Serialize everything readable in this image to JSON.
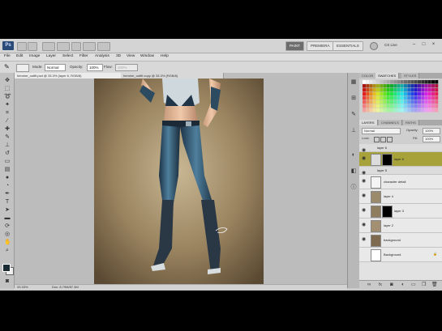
{
  "appbar": {
    "logo": "Ps",
    "workspaces": [
      "PAINT",
      "PREMIERA",
      "ESSENTIALS"
    ],
    "active_workspace": "PAINT",
    "cs_live": "CS Live",
    "minimize": "–",
    "maximize": "□",
    "close": "×"
  },
  "menu": [
    "File",
    "Edit",
    "Image",
    "Layer",
    "Select",
    "Filter",
    "Analysis",
    "3D",
    "View",
    "Window",
    "Help"
  ],
  "options": {
    "mode_label": "Mode:",
    "mode_value": "Normal",
    "opacity_label": "Opacity:",
    "opacity_value": "100%",
    "flow_label": "Flow:",
    "flow_value": "100%"
  },
  "tools": [
    "move",
    "marquee",
    "lasso",
    "quick-select",
    "crop",
    "eyedropper",
    "healing",
    "brush",
    "clone-stamp",
    "history-brush",
    "eraser",
    "gradient",
    "blur",
    "dodge",
    "pen",
    "type",
    "path-select",
    "shape",
    "3d-rotate",
    "3d-orbit",
    "hand",
    "zoom"
  ],
  "document": {
    "tabs": [
      "heroine_outfit.psd @ 33.3% (layer 6, RGB/8)",
      "heroine_outfit copy @ 33.3% (RGB/8)"
    ],
    "status_zoom": "33.33%",
    "status_doc": "Doc: 8.79M/87.3M"
  },
  "panels": {
    "top_tabs": [
      "COLOR",
      "SWATCHES",
      "STYLES"
    ],
    "active_top_tab": "SWATCHES",
    "layer_tabs": [
      "LAYERS",
      "CHANNELS",
      "PATHS"
    ],
    "active_layer_tab": "LAYERS",
    "blend_mode": "Normal",
    "opacity_label": "Opacity:",
    "opacity_value": "100%",
    "lock_label": "Lock:",
    "fill_label": "Fill:",
    "fill_value": "100%",
    "layers": [
      {
        "name": "layer 6",
        "type": "group",
        "visible": true,
        "selected": false
      },
      {
        "name": "layer 6",
        "type": "mask",
        "visible": true,
        "selected": true
      },
      {
        "name": "layer 5",
        "type": "group",
        "visible": true,
        "selected": false
      },
      {
        "name": "character detail",
        "type": "thumb",
        "visible": true,
        "selected": false
      },
      {
        "name": "layer 4",
        "type": "thumb",
        "visible": true,
        "selected": false
      },
      {
        "name": "layer 3",
        "type": "mask",
        "visible": true,
        "selected": false
      },
      {
        "name": "layer 2",
        "type": "thumb",
        "visible": true,
        "selected": false
      },
      {
        "name": "background",
        "type": "thumb",
        "visible": true,
        "selected": false
      },
      {
        "name": "Background",
        "type": "plain",
        "visible": false,
        "selected": false
      }
    ],
    "fx_badge": "fx"
  },
  "colors": {
    "selected_layer": "#a7a33a",
    "foreground": "#1c2b34",
    "background": "#eeeeee",
    "canvas_backdrop": "#8a7452"
  }
}
